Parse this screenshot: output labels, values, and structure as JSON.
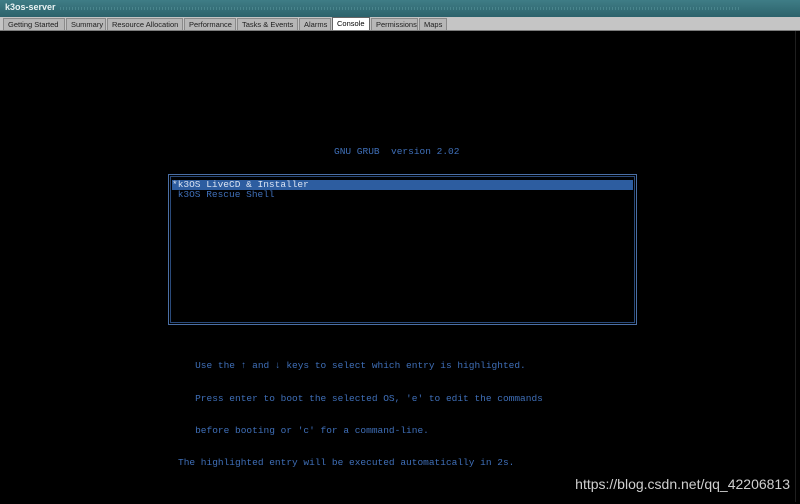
{
  "window": {
    "title": "k3os-server"
  },
  "tabs": [
    {
      "label": "Getting Started"
    },
    {
      "label": "Summary"
    },
    {
      "label": "Resource Allocation"
    },
    {
      "label": "Performance"
    },
    {
      "label": "Tasks & Events"
    },
    {
      "label": "Alarms"
    },
    {
      "label": "Console"
    },
    {
      "label": "Permissions"
    },
    {
      "label": "Maps"
    }
  ],
  "active_tab": "Console",
  "console": {
    "grub_title": "GNU GRUB  version 2.02",
    "entries": [
      {
        "label": "*k3OS LiveCD & Installer",
        "selected": true
      },
      {
        "label": " k3OS Rescue Shell",
        "selected": false
      }
    ],
    "help_lines": [
      "   Use the ↑ and ↓ keys to select which entry is highlighted.",
      "   Press enter to boot the selected OS, 'e' to edit the commands",
      "   before booting or 'c' for a command-line.",
      "The highlighted entry will be executed automatically in 2s."
    ]
  },
  "watermark": "https://blog.csdn.net/qq_42206813",
  "colors": {
    "titlebar": "#2c626b",
    "console_bg": "#000000",
    "grub_text": "#3f6fb8",
    "highlight": "#2d5da0"
  }
}
